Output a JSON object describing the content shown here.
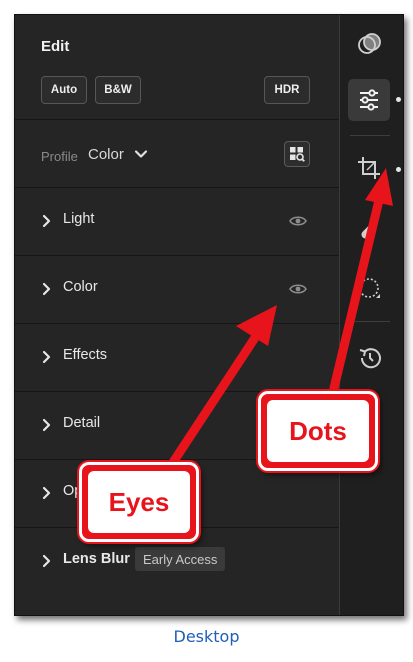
{
  "edit": {
    "title": "Edit",
    "buttons": {
      "auto": "Auto",
      "bw": "B&W",
      "hdr": "HDR"
    }
  },
  "profile": {
    "label": "Profile",
    "value": "Color"
  },
  "sections": [
    {
      "label": "Light",
      "eye": true
    },
    {
      "label": "Color",
      "eye": true
    },
    {
      "label": "Effects",
      "eye": false
    },
    {
      "label": "Detail",
      "eye": false
    },
    {
      "label": "Op",
      "eye": false
    },
    {
      "label": "Lens Blur",
      "eye": false,
      "badge": "Early Access"
    }
  ],
  "rail": {
    "icons": [
      "presets-icon",
      "edit-sliders-icon",
      "crop-icon",
      "healing-icon",
      "masking-icon",
      "history-icon"
    ],
    "active": "edit-sliders-icon"
  },
  "annotations": {
    "eyes_label": "Eyes",
    "dots_label": "Dots",
    "caption": "Desktop",
    "arrow_color": "#e8141b"
  },
  "colors": {
    "panel_bg": "#252525",
    "rail_bg": "#1f1f1f",
    "text": "#e8e8e8",
    "muted": "#8a8a8a"
  }
}
